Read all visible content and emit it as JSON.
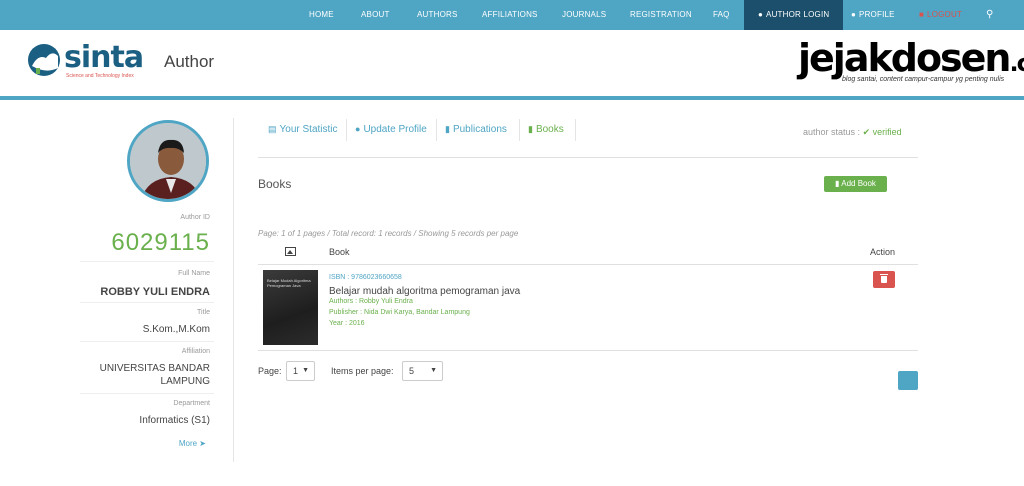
{
  "nav": {
    "items": [
      "HOME",
      "ABOUT",
      "AUTHORS",
      "AFFILIATIONS",
      "JOURNALS",
      "REGISTRATION",
      "FAQ"
    ],
    "author_login": "AUTHOR LOGIN",
    "profile": "PROFILE",
    "logout": "LOGOUT"
  },
  "header": {
    "logo_text": "sinta",
    "logo_sub": "Science and Technology Index",
    "page_heading": "Author",
    "watermark_title": "jejakdosen",
    "watermark_domain": ".com",
    "watermark_sub": "blog santai, content campur-campur yg penting nulis"
  },
  "sidebar": {
    "author_id_label": "Author ID",
    "author_id": "6029115",
    "full_name_label": "Full Name",
    "full_name": "ROBBY YULI ENDRA",
    "title_label": "Title",
    "title": "S.Kom.,M.Kom",
    "affiliation_label": "Affiliation",
    "affiliation_line1": "UNIVERSITAS BANDAR",
    "affiliation_line2": "LAMPUNG",
    "department_label": "Department",
    "department": "Informatics (S1)",
    "more": "More"
  },
  "tabs": [
    "Your Statistic",
    "Update Profile",
    "Publications",
    "Books"
  ],
  "status": {
    "label": "author status :",
    "value": "verified"
  },
  "books": {
    "title": "Books",
    "add_button": "Add Book",
    "page_info": "Page: 1 of 1 pages / Total record: 1 records / Showing 5 records per page",
    "columns": [
      "Book",
      "Action"
    ],
    "rows": [
      {
        "cover_title": "Belajar Mudah Algoritma Pemograman Java",
        "isbn": "ISBN : 9786023660658",
        "title": "Belajar mudah algoritma pemograman java",
        "authors": "Authors : Robby Yuli Endra",
        "publisher": "Publisher : Nida Dwi Karya, Bandar Lampung",
        "year": "Year : 2016"
      }
    ]
  },
  "pagination": {
    "page_label": "Page:",
    "page_value": "1",
    "per_page_label": "Items per page:",
    "per_page_value": "5"
  },
  "colors": {
    "nav": "#4fa5c4",
    "nav_active": "#1b4f6b",
    "accent_green": "#6ab04c",
    "danger": "#d9534f"
  }
}
